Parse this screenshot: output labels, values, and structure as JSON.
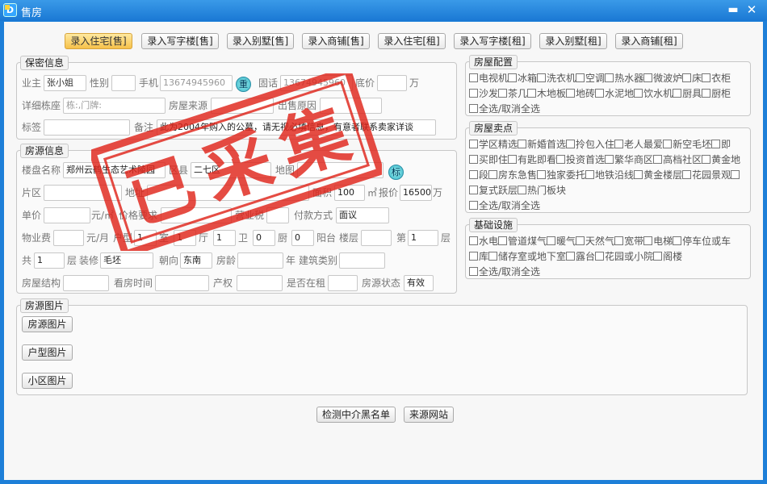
{
  "window": {
    "title": "售房",
    "icon_text": "D",
    "minimize": "▬",
    "close": "✕"
  },
  "tabs": [
    "录入住宅[售]",
    "录入写字楼[售]",
    "录入别墅[售]",
    "录入商铺[售]",
    "录入住宅[租]",
    "录入写字楼[租]",
    "录入别墅[租]",
    "录入商铺[租]"
  ],
  "confidential": {
    "legend": "保密信息",
    "owner_label": "业主",
    "owner_value": "张小姐",
    "gender_label": "性别",
    "gender_value": "",
    "mobile_label": "手机",
    "mobile_value": "13674945960",
    "dup_btn": "重",
    "phone_label": "固话",
    "phone_value": "13674945960",
    "base_price_label": "底价",
    "base_price_value": "",
    "base_price_unit": "万",
    "address_label": "详细栋座",
    "address_value": "栋:,门牌:",
    "source_label": "房屋来源",
    "source_value": "",
    "reason_label": "出售原因",
    "reason_value": "",
    "tag_label": "标签",
    "tag_value": "",
    "remark_label": "备注",
    "remark_value": "此为2004年购入的公墓，请无视必填信息，有意者联系卖家详谈"
  },
  "listing": {
    "legend": "房源信息",
    "estate_label": "楼盘名称",
    "estate_value": "郑州云鹤生态艺术陵园",
    "district_label": "区县",
    "district_value": "二七区",
    "map_label": "地图",
    "map_value": "",
    "tag_btn": "标",
    "area_zone_label": "片区",
    "area_zone_value": "",
    "location_label": "地址",
    "location_value": "",
    "area_label": "面积",
    "area_value": "100",
    "area_unit": "㎡",
    "quote_label": "报价",
    "quote_value": "16500",
    "quote_unit": "万",
    "unit_price_label": "单价",
    "unit_price_value": "",
    "unit_price_unit": "元/㎡",
    "price_req_label": "价格要求",
    "price_req_value": "",
    "tax_label": "营业税",
    "tax_value": "",
    "payment_label": "付款方式",
    "payment_value": "面议",
    "mgmt_fee_label": "物业费",
    "mgmt_fee_value": "",
    "mgmt_fee_unit": "元/月",
    "layout_label": "户型",
    "rooms_value": "1",
    "rooms_unit": "室",
    "halls_value": "1",
    "halls_unit": "厅",
    "baths_value": "1",
    "baths_unit": "卫",
    "kitchens_value": "0",
    "kitchens_unit": "厨",
    "balcony_value": "0",
    "balcony_unit": "阳台",
    "floor_label": "楼层",
    "floor_value": "",
    "floor_no_label": "第",
    "floor_no_value": "1",
    "floor_no_unit": "层",
    "total_label": "共",
    "total_value": "1",
    "total_unit": "层",
    "decor_label": "装修",
    "decor_value": "毛坯",
    "facing_label": "朝向",
    "facing_value": "东南",
    "age_label": "房龄",
    "age_value": "",
    "age_unit": "年",
    "btype_label": "建筑类别",
    "btype_value": "",
    "structure_label": "房屋结构",
    "structure_value": "",
    "viewing_label": "看房时间",
    "viewing_value": "",
    "rights_label": "产权",
    "rights_value": "",
    "rented_label": "是否在租",
    "rented_value": "",
    "status_label": "房源状态",
    "status_value": "有效"
  },
  "config": {
    "legend": "房屋配置",
    "lines": [
      [
        "电视机",
        "冰箱",
        "洗衣机",
        "空调",
        "热水器",
        "微波炉",
        "床",
        "衣柜"
      ],
      [
        "沙发",
        "茶几",
        "木地板",
        "地砖",
        "水泥地",
        "饮水机",
        "厨具",
        "厨柜"
      ]
    ],
    "select_all": "全选/取消全选"
  },
  "selling_points": {
    "legend": "房屋卖点",
    "lines": [
      [
        "学区精选",
        "新婚首选",
        "拎包入住",
        "老人最爱",
        "新空毛坯",
        "即"
      ],
      [
        "买即住",
        "有匙即看",
        "投资首选",
        "繁华商区",
        "高档社区",
        "黄金地"
      ],
      [
        "段",
        "房东急售",
        "独家委托",
        "地铁沿线",
        "黄金楼层",
        "花园景观",
        ""
      ],
      [
        "复式跃层",
        "热门板块"
      ]
    ],
    "select_all": "全选/取消全选"
  },
  "facilities": {
    "legend": "基础设施",
    "lines": [
      [
        "水电",
        "管道煤气",
        "暖气",
        "天然气",
        "宽带",
        "电梯",
        "停车位或车"
      ],
      [
        "库",
        "储存室或地下室",
        "露台",
        "花园或小院",
        "阁楼"
      ]
    ],
    "select_all": "全选/取消全选"
  },
  "photos": {
    "legend": "房源图片",
    "buttons": [
      "房源图片",
      "户型图片",
      "小区图片"
    ]
  },
  "footer": {
    "check_btn": "检测中介黑名单",
    "source_btn": "来源网站"
  },
  "stamp": {
    "text_1": "已",
    "text_2": "采",
    "text_3": "集",
    "color": "#e0251b"
  }
}
